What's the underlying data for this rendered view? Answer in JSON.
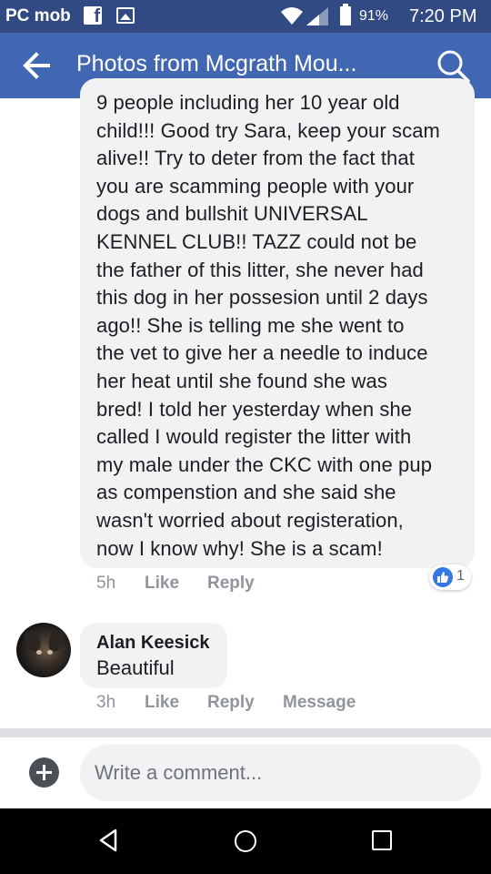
{
  "status_bar": {
    "carrier": "PC mob",
    "battery": "91%",
    "time": "7:20 PM"
  },
  "header": {
    "title": "Photos from Mcgrath Mou..."
  },
  "comment": {
    "lines": [
      "9 people including her 10 year old",
      "child!!! Good try Sara, keep your scam",
      "alive!! Try to deter from the fact that",
      "you are scamming people with your",
      "dogs and bullshit UNIVERSAL",
      "KENNEL CLUB!! TAZZ could not be",
      "the father of this litter, she never had",
      "this dog in her possesion until 2 days",
      "ago!! She is telling me she went to",
      "the vet to give her a needle to induce",
      "her heat until she found she was",
      "bred! I told her yesterday when she",
      "called I would register the litter with",
      "my male under the CKC with one pup",
      "as compenstion and she said she",
      "wasn't worried about registeration,",
      "now I know why! She is a scam!"
    ],
    "time": "5h",
    "like_label": "Like",
    "reply_label": "Reply",
    "reaction_count": "1"
  },
  "reply": {
    "author": "Alan Keesick",
    "text": "Beautiful",
    "time": "3h",
    "like_label": "Like",
    "reply_label": "Reply",
    "message_label": "Message"
  },
  "composer": {
    "placeholder": "Write a comment..."
  },
  "colors": {
    "status_bar": "#314a84",
    "app_bar": "#4267b2",
    "bubble": "#f1f2f4",
    "like_blue": "#3578e5"
  },
  "icons": {
    "back": "arrow-left-icon",
    "search": "search-icon",
    "add": "plus-circle-icon",
    "like": "thumbs-up-icon"
  }
}
